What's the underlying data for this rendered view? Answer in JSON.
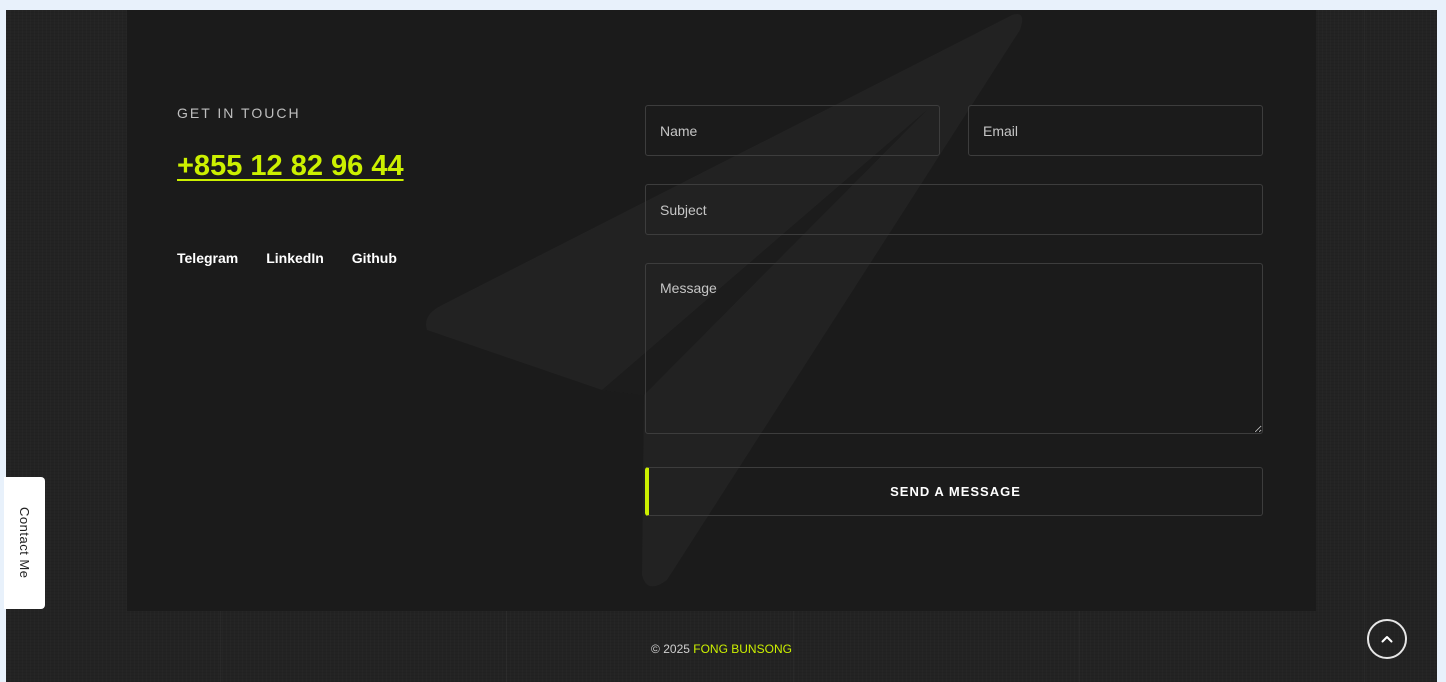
{
  "contact": {
    "eyebrow": "GET IN TOUCH",
    "phone": "+855 12 82 96 44",
    "social_links": [
      "Telegram",
      "LinkedIn",
      "Github"
    ]
  },
  "form": {
    "name_placeholder": "Name",
    "email_placeholder": "Email",
    "subject_placeholder": "Subject",
    "message_placeholder": "Message",
    "send_label": "SEND A MESSAGE"
  },
  "footer": {
    "copyright": "© 2025 ",
    "owner": "FONG BUNSONG"
  },
  "side_tab": {
    "label": "Contact Me"
  },
  "scroll_top": {
    "icon": "chevron-up-icon"
  },
  "colors": {
    "accent": "#ccf000",
    "panel": "#1b1b1b",
    "background": "#232323"
  }
}
